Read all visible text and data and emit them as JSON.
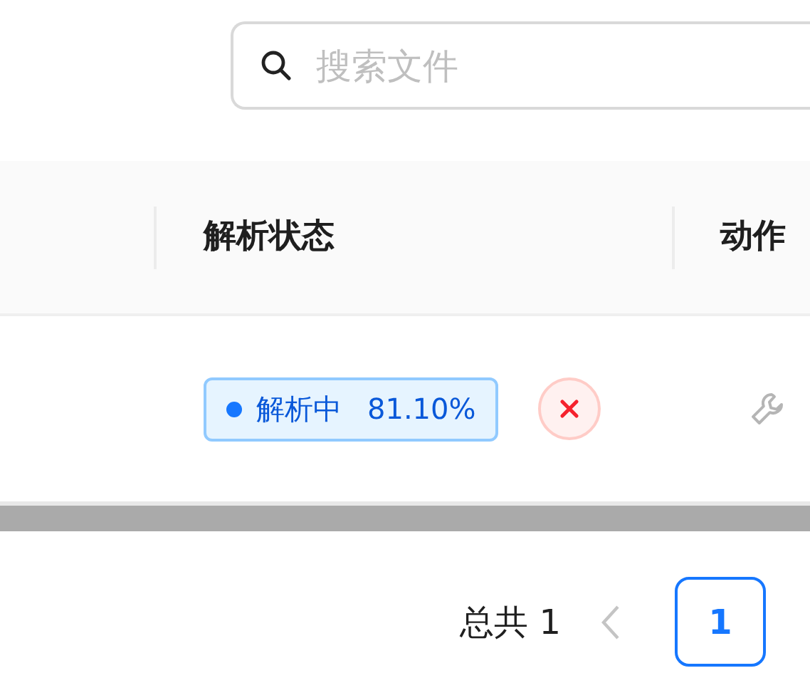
{
  "search": {
    "placeholder": "搜索文件"
  },
  "table": {
    "columns": [
      {
        "label": "解析状态"
      },
      {
        "label": "动作"
      }
    ],
    "rows": [
      {
        "status": {
          "label": "解析中",
          "progress": "81.10%"
        }
      }
    ]
  },
  "pagination": {
    "total": "总共 1",
    "prev_disabled": true,
    "pages": [
      {
        "label": "1",
        "selected": true
      }
    ]
  }
}
